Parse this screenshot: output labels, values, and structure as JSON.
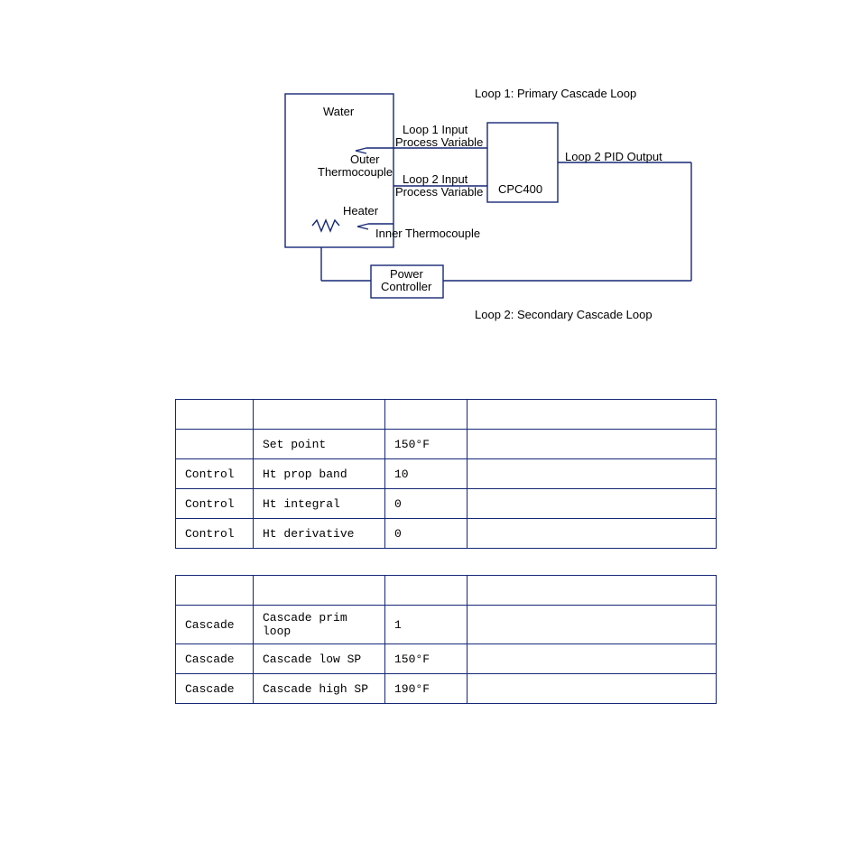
{
  "diagram": {
    "loop1_title": "Loop 1: Primary Cascade Loop",
    "loop2_title": "Loop 2: Secondary Cascade Loop",
    "water": "Water",
    "outer_tc1": "Outer",
    "outer_tc2": "Thermocouple",
    "heater": "Heater",
    "loop1_in1": "Loop 1 Input",
    "loop1_in2": "Process Variable",
    "loop2_in1": "Loop 2 Input",
    "loop2_in2": "Process Variable",
    "cpc": "CPC400",
    "loop2_out": "Loop 2 PID Output",
    "inner_tc": "Inner Thermocouple",
    "power1": "Power",
    "power2": "Controller"
  },
  "table1": {
    "rows": [
      {
        "c1": "",
        "c2": "Set point",
        "c3": "150°F",
        "c4": ""
      },
      {
        "c1": "Control",
        "c2": "Ht prop band",
        "c3": "10",
        "c4": ""
      },
      {
        "c1": "Control",
        "c2": "Ht integral",
        "c3": "0",
        "c4": ""
      },
      {
        "c1": "Control",
        "c2": "Ht derivative",
        "c3": "0",
        "c4": ""
      }
    ]
  },
  "table2": {
    "rows": [
      {
        "c1": "Cascade",
        "c2": "Cascade prim loop",
        "c3": "1",
        "c4": ""
      },
      {
        "c1": "Cascade",
        "c2": "Cascade low SP",
        "c3": "150°F",
        "c4": ""
      },
      {
        "c1": "Cascade",
        "c2": "Cascade high SP",
        "c3": "190°F",
        "c4": ""
      }
    ]
  }
}
